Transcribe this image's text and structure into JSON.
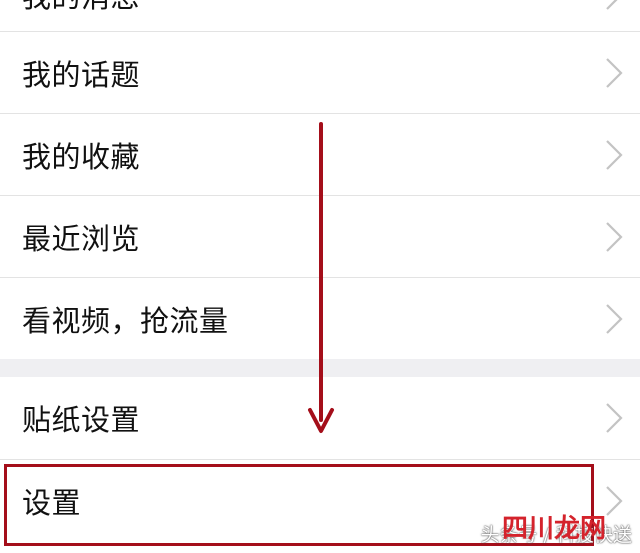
{
  "menu": {
    "items": [
      {
        "label": "我的消息"
      },
      {
        "label": "我的话题"
      },
      {
        "label": "我的收藏"
      },
      {
        "label": "最近浏览"
      },
      {
        "label": "看视频，抢流量"
      }
    ],
    "items_group2": [
      {
        "label": "贴纸设置"
      },
      {
        "label": "设置"
      }
    ]
  },
  "annotation": {
    "arrow_color": "#a40e1a",
    "highlight_color": "#a40e1a"
  },
  "watermark": {
    "text": "头条号 / 科技快送",
    "brand": "四川龙网"
  },
  "icons": {
    "chevron": "chevron-right-icon",
    "arrow": "down-arrow-icon"
  }
}
